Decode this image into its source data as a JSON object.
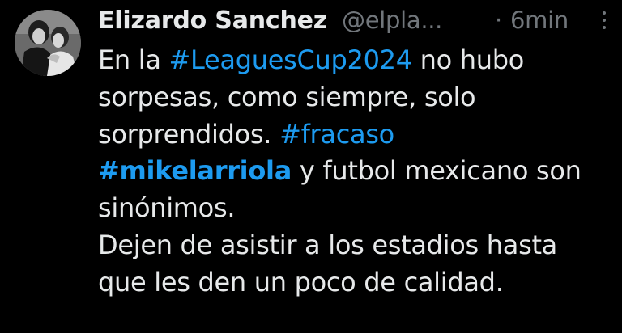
{
  "tweet": {
    "author": {
      "display_name": "Elizardo Sanchez",
      "handle": "@elpla...",
      "avatar": "profile-photo-couple-black-and-white"
    },
    "separator": "·",
    "timestamp": "6min",
    "more_icon": "vertical-ellipsis-icon",
    "lines": [
      {
        "before": "En la ",
        "hashtag": "#LeaguesCup2024",
        "after": " no hubo"
      },
      {
        "text": "sorpesas, como siempre, solo"
      },
      {
        "before": "sorprendidos. ",
        "hashtag": "#fracaso"
      },
      {
        "hashtag": "#mikelarriola",
        "after": " y futbol mexicano son"
      },
      {
        "text": "sinónimos."
      },
      {
        "text": "Dejen de asistir a los estadios hasta"
      },
      {
        "text": "que les den un poco de calidad."
      }
    ]
  },
  "colors": {
    "background": "#000000",
    "primary_text": "#e7e9ea",
    "secondary_text": "#71767b",
    "hashtag": "#1d9bf0"
  }
}
